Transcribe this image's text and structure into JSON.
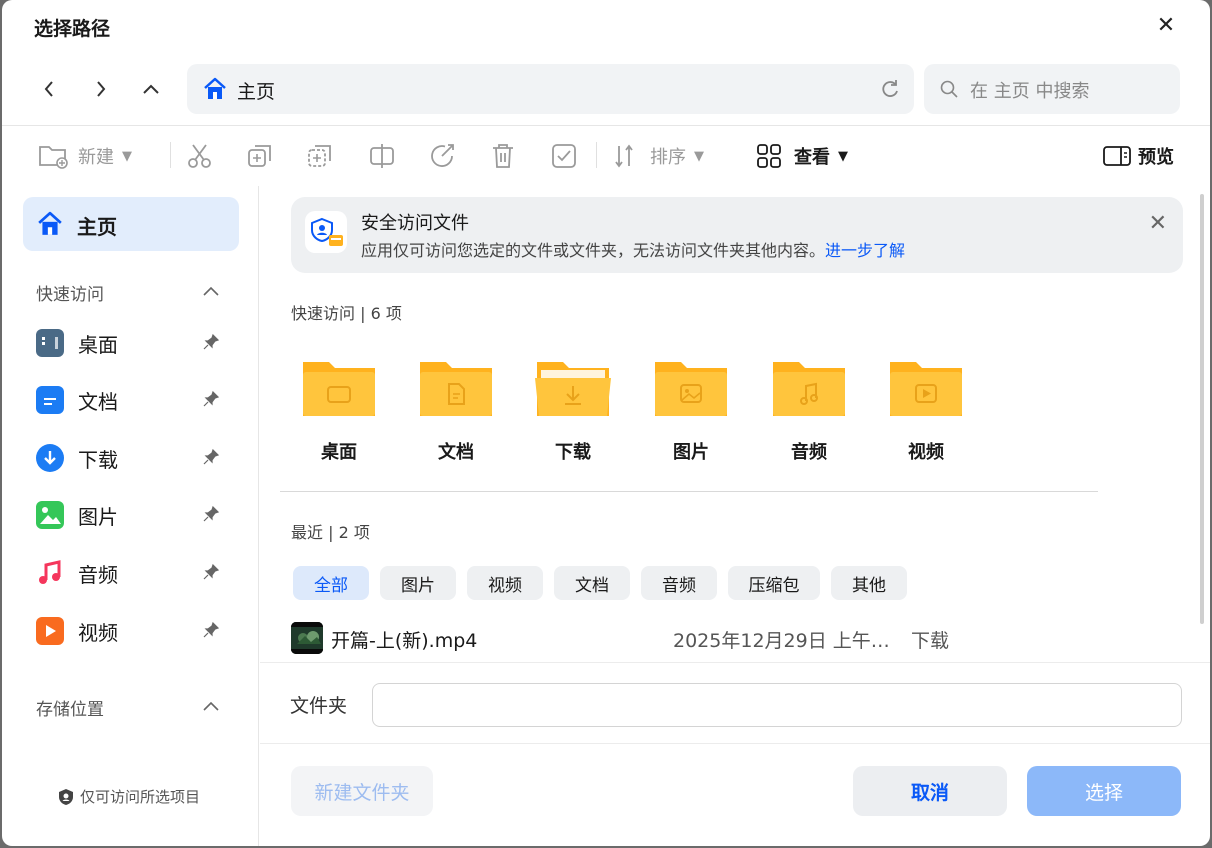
{
  "dialog": {
    "title": "选择路径"
  },
  "address": {
    "path": "主页"
  },
  "search": {
    "placeholder": "在 主页 中搜索"
  },
  "toolbar": {
    "new_label": "新建",
    "sort_label": "排序",
    "view_label": "查看",
    "preview_label": "预览"
  },
  "sidebar": {
    "home": "主页",
    "quick_access": "快速访问",
    "items": [
      {
        "label": "桌面",
        "icon": "desktop-icon",
        "color": "#4a6a86"
      },
      {
        "label": "文档",
        "icon": "document-icon",
        "color": "#1c7cf4"
      },
      {
        "label": "下载",
        "icon": "download-icon",
        "color": "#1c7cf4"
      },
      {
        "label": "图片",
        "icon": "picture-icon",
        "color": "#35c759"
      },
      {
        "label": "音频",
        "icon": "music-icon",
        "color": "#f5365c"
      },
      {
        "label": "视频",
        "icon": "video-icon",
        "color": "#f96b1f"
      }
    ],
    "storage": "存储位置",
    "footer": "仅可访问所选项目"
  },
  "banner": {
    "title": "安全访问文件",
    "desc": "应用仅可访问您选定的文件或文件夹，无法访问文件夹其他内容。",
    "link": "进一步了解"
  },
  "quick_section": {
    "title": "快速访问 | 6 项"
  },
  "folders": [
    {
      "label": "桌面",
      "icon": "desktop-folder-icon"
    },
    {
      "label": "文档",
      "icon": "document-folder-icon"
    },
    {
      "label": "下载",
      "icon": "download-folder-icon"
    },
    {
      "label": "图片",
      "icon": "picture-folder-icon"
    },
    {
      "label": "音频",
      "icon": "music-folder-icon"
    },
    {
      "label": "视频",
      "icon": "video-folder-icon"
    }
  ],
  "recent_section": {
    "title": "最近 | 2 项"
  },
  "filters": [
    "全部",
    "图片",
    "视频",
    "文档",
    "音频",
    "压缩包",
    "其他"
  ],
  "recent_files": [
    {
      "name": "开篇-上(新).mp4",
      "date": "2025年12月29日 上午…",
      "location": "下载"
    }
  ],
  "folder_field": {
    "label": "文件夹",
    "value": ""
  },
  "buttons": {
    "new_folder": "新建文件夹",
    "cancel": "取消",
    "select": "选择"
  },
  "colors": {
    "accent": "#0a59f7",
    "folder": "#ffc53d",
    "select_button": "#8cb8f9"
  }
}
